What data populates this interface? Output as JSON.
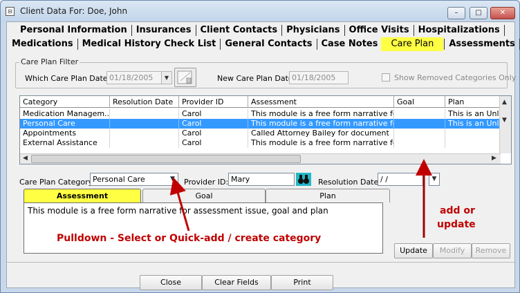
{
  "window": {
    "title": "Client Data For: Doe, John",
    "app_icon": "client-data-app-icon",
    "minimize_glyph": "–",
    "maximize_glyph": "□",
    "close_glyph": "✕"
  },
  "tabs": {
    "row1": [
      "Personal Information",
      "Insurances",
      "Client Contacts",
      "Physicians",
      "Office Visits",
      "Hospitalizations"
    ],
    "row2": [
      "Medications",
      "Medical History Check List",
      "General Contacts",
      "Case Notes",
      "Care Plan",
      "Assessments"
    ],
    "active": "Care Plan"
  },
  "filter": {
    "group_label": "Care Plan Filter",
    "which_date_label": "Which Care Plan Date:",
    "which_date_value": "01/18/2005",
    "new_date_label": "New Care Plan Date:",
    "new_date_value": "01/18/2005",
    "show_removed_label": "Show Removed Categories Only"
  },
  "grid": {
    "columns": [
      "Category",
      "Resolution Date",
      "Provider ID",
      "Assessment",
      "Goal",
      "Plan"
    ],
    "rows": [
      [
        "Medication Managem...",
        "",
        "Carol",
        "This module is a free form narrative for a...",
        "",
        "This is an Unlim"
      ],
      [
        "Personal Care",
        "",
        "Carol",
        "This module is a free form narrative for a...",
        "",
        "This is an Unlim"
      ],
      [
        "Appointments",
        "",
        "Carol",
        "Called Attorney Bailey for document",
        "",
        ""
      ],
      [
        "External Assistance",
        "",
        "Carol",
        "This module is a free form narrative for a...",
        "",
        ""
      ]
    ],
    "selected_row": 1
  },
  "detail": {
    "category_label": "Care Plan Category:",
    "category_value": "Personal Care",
    "provider_label": "Provider ID:",
    "provider_value": "Mary",
    "resolution_label": "Resolution Date:",
    "resolution_value": " / /",
    "subtabs": [
      "Assessment",
      "Goal",
      "Plan"
    ],
    "memo_text": "This module is a free form narrative for assessment issue, goal and plan"
  },
  "buttons": {
    "update": "Update",
    "modify": "Modify",
    "remove": "Remove",
    "close": "Close",
    "clear_fields": "Clear Fields",
    "print": "Print"
  },
  "annotations": {
    "pulldown": "Pulldown - Select or Quick-add / create category",
    "add_update_line1": "add or",
    "add_update_line2": "update",
    "color": "#c00000"
  }
}
